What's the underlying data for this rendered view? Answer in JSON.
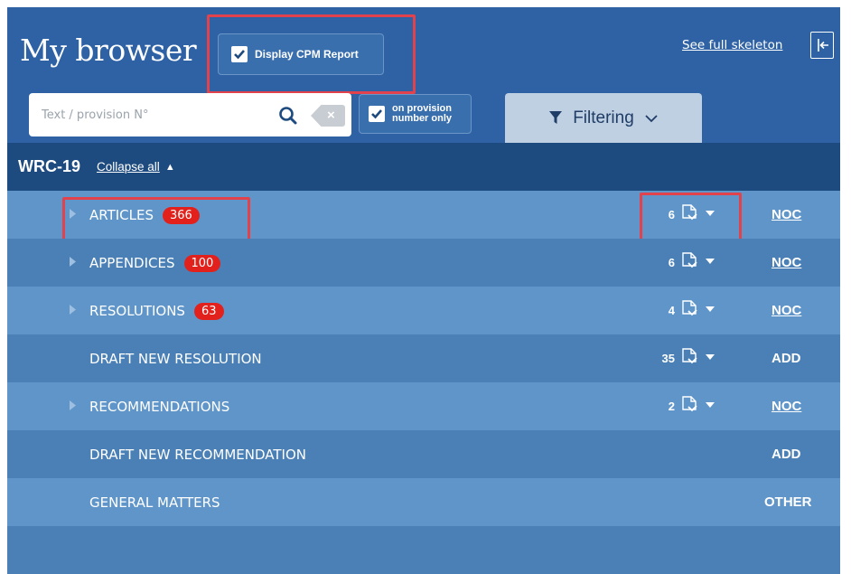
{
  "header": {
    "title": "My browser",
    "cpm_label": "Display CPM Report",
    "see_full": "See full skeleton"
  },
  "search": {
    "placeholder": "Text / provision N°",
    "clear": "×",
    "provision_only_line1": "on provision",
    "provision_only_line2": "number only"
  },
  "filter": {
    "label": "Filtering"
  },
  "section": {
    "title": "WRC-19",
    "collapse_all": "Collapse all"
  },
  "rows": [
    {
      "label": "ARTICLES",
      "badge": "366",
      "count": "6",
      "action": "NOC"
    },
    {
      "label": "APPENDICES",
      "badge": "100",
      "count": "6",
      "action": "NOC"
    },
    {
      "label": "RESOLUTIONS",
      "badge": "63",
      "count": "4",
      "action": "NOC"
    },
    {
      "label": "DRAFT NEW RESOLUTION",
      "count": "35",
      "action": "ADD"
    },
    {
      "label": "RECOMMENDATIONS",
      "count": "2",
      "action": "NOC"
    },
    {
      "label": "DRAFT NEW RECOMMENDATION",
      "action": "ADD"
    },
    {
      "label": "GENERAL MATTERS",
      "action": "OTHER"
    }
  ],
  "colors": {
    "header_bg": "#2e62a4",
    "section_bg": "#1d4a7f",
    "row_light": "#5f95c9",
    "row_dark": "#4a80b6",
    "badge": "#e2211c",
    "highlight": "#e2424b",
    "filter_tab": "#bfd0e3"
  }
}
